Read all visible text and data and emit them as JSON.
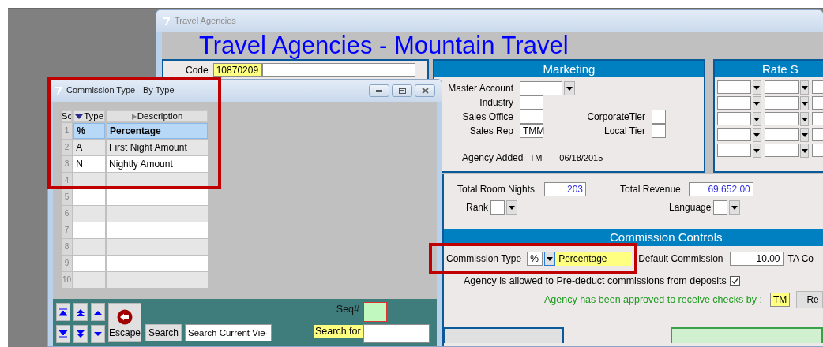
{
  "main_window": {
    "title": "Travel Agencies",
    "heading": "Travel Agencies - Mountain Travel",
    "code": {
      "label": "Code",
      "value": "10870209"
    },
    "marketing": {
      "title": "Marketing",
      "fields": [
        {
          "label": "Master Account",
          "kind": "combo"
        },
        {
          "label": "Industry",
          "kind": "box"
        },
        {
          "label": "Sales Office",
          "kind": "box"
        },
        {
          "label": "Sales Rep",
          "kind": "box",
          "value": "TMM"
        }
      ],
      "tiers": [
        {
          "label": "CorporateTier"
        },
        {
          "label": "Local Tier"
        }
      ],
      "added": {
        "label": "Agency Added",
        "by": "TM",
        "date": "06/18/2015"
      }
    },
    "rate": {
      "title": "Rate S"
    },
    "totals": [
      {
        "label": "Total Room Nights",
        "value": "203"
      },
      {
        "label": "Total Revenue",
        "value": "69,652.00"
      }
    ],
    "selectors": [
      {
        "label": "Rank"
      },
      {
        "label": "Language"
      }
    ],
    "commission": {
      "title": "Commission Controls",
      "type_label": "Commission Type",
      "type_code": "%",
      "type_name": "Percentage",
      "default_label": "Default Commission",
      "default_value": "10.00",
      "ta_label": "TA Co",
      "prededuct": {
        "label": "Agency is allowed to Pre-deduct commissions from deposits",
        "checked": true
      },
      "approved": {
        "label": "Agency has been approved to receive checks by :",
        "value": "TM"
      },
      "button": "Re"
    }
  },
  "dialog": {
    "title": "Commission Type - By Type",
    "columns": [
      {
        "label": "Sc",
        "kind": "plain"
      },
      {
        "label": "Type",
        "kind": "sorted"
      },
      {
        "label": "Description",
        "kind": "sortable"
      }
    ],
    "rows": [
      {
        "num": "1",
        "type": "%",
        "description": "Percentage",
        "selected": true
      },
      {
        "num": "2",
        "type": "A",
        "description": "First Night Amount",
        "selected": false
      },
      {
        "num": "3",
        "type": "N",
        "description": "Nightly Amount",
        "selected": false
      },
      {
        "num": "4",
        "selected": false
      },
      {
        "num": "5",
        "selected": false
      },
      {
        "num": "6",
        "selected": false
      },
      {
        "num": "7",
        "selected": false
      },
      {
        "num": "8",
        "selected": false
      },
      {
        "num": "9",
        "selected": false
      },
      {
        "num": "10",
        "selected": false
      }
    ],
    "escape": "Escape",
    "search_button": "Search",
    "search_scope": "Search Current Vie",
    "seq_label": "Seq#",
    "search_for_label": "Search for"
  }
}
